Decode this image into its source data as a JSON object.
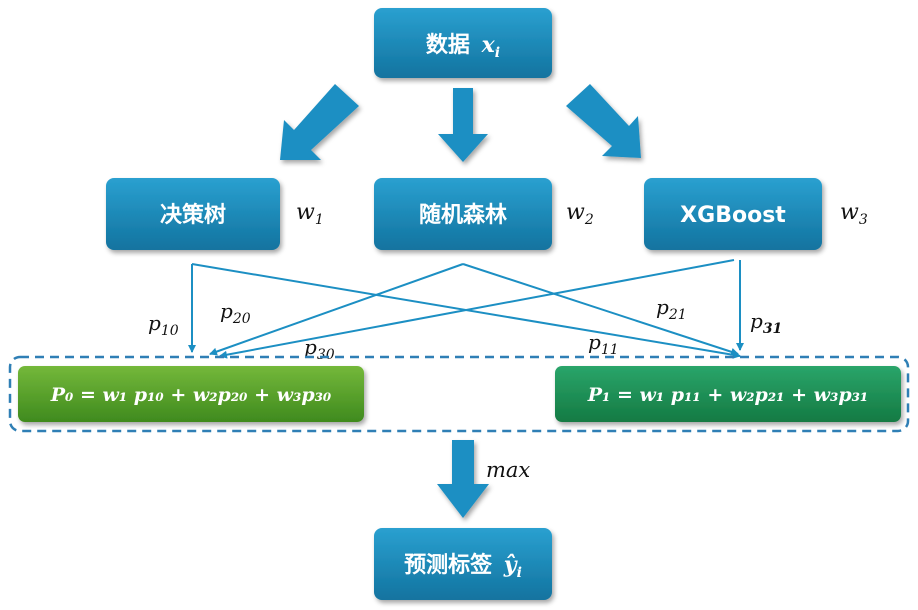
{
  "colors": {
    "box_blue_top": "#2aa0d0",
    "box_blue_bottom": "#12739f",
    "green_left_top": "#74b83a",
    "green_left_bottom": "#3f8a1e",
    "green_right_top": "#2aa56a",
    "green_right_bottom": "#147a43",
    "arrow": "#1c8fc3",
    "dashed_border": "#2f7fb5"
  },
  "nodes": {
    "data": {
      "label": "数据",
      "var": "x",
      "sub": "i"
    },
    "tree": {
      "label": "决策树"
    },
    "forest": {
      "label": "随机森林"
    },
    "xgb": {
      "label": "XGBoost"
    },
    "pred": {
      "label": "预测标签",
      "var": "ŷ",
      "sub": "i"
    }
  },
  "weights": [
    {
      "var": "w",
      "sub": "1"
    },
    {
      "var": "w",
      "sub": "2"
    },
    {
      "var": "w",
      "sub": "3"
    }
  ],
  "prob_labels": {
    "p10": {
      "var": "p",
      "sub": "10"
    },
    "p20": {
      "var": "p",
      "sub": "20"
    },
    "p30": {
      "var": "p",
      "sub": "30"
    },
    "p21": {
      "var": "p",
      "sub": "21"
    },
    "p11": {
      "var": "p",
      "sub": "11"
    },
    "p31": {
      "var": "p",
      "sub": "31"
    }
  },
  "formulas": {
    "p0": "P₀ = w₁ p₁₀ + w₂p₂₀ + w₃p₃₀",
    "p1": "P₁ = w₁ p₁₁ + w₂p₂₁ + w₃p₃₁"
  },
  "max_label": "max"
}
